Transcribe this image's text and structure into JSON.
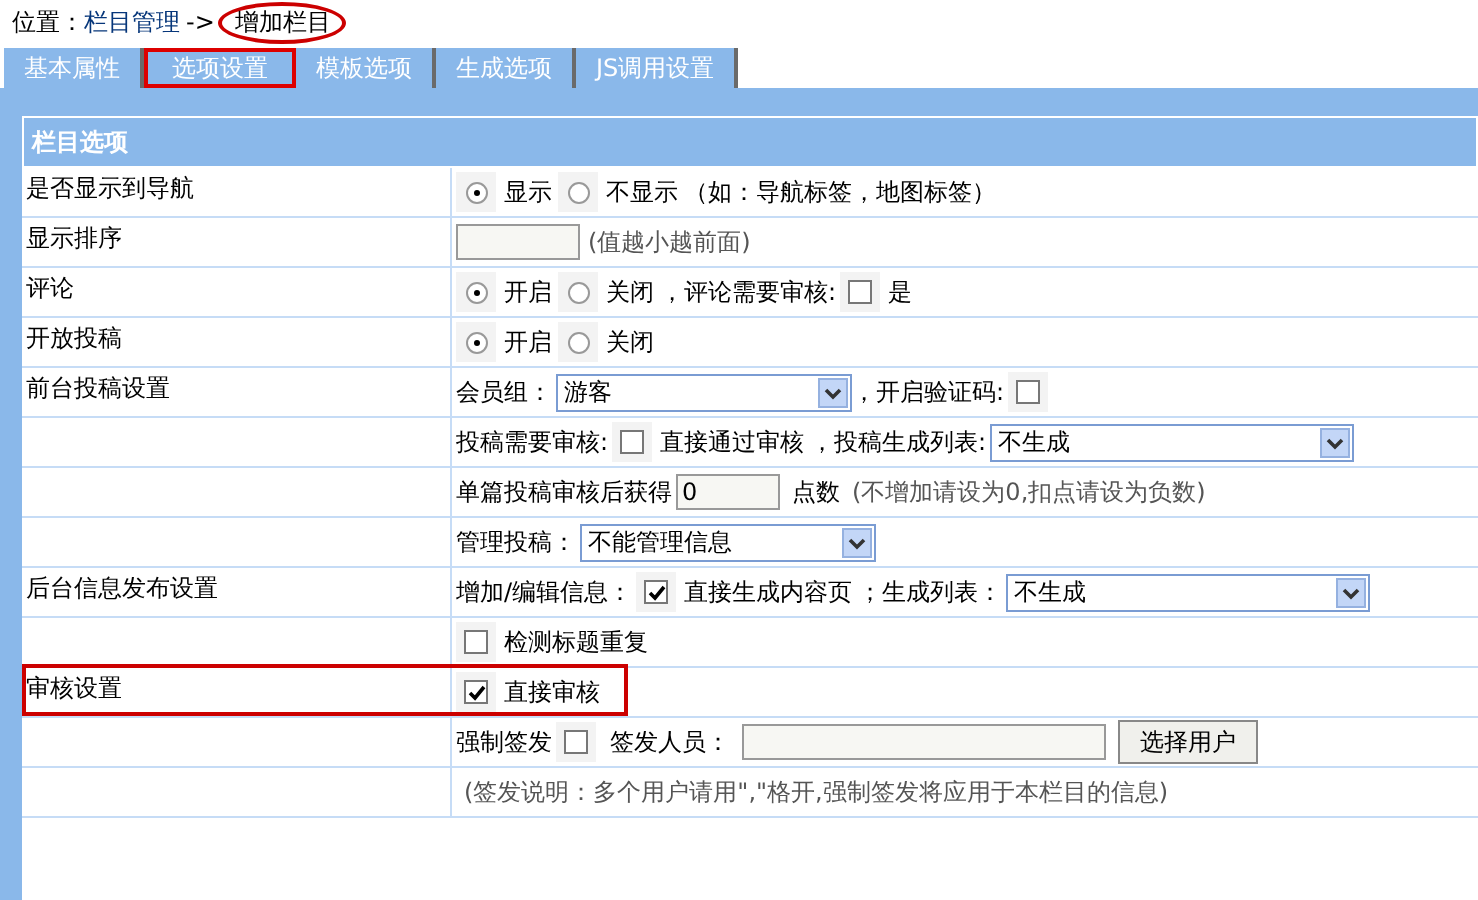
{
  "breadcrumb": {
    "prefix": "位置：",
    "link": "栏目管理",
    "separator": "->",
    "current": "增加栏目",
    "current_circled": true
  },
  "tabs": [
    {
      "label": "基本属性",
      "selected": false
    },
    {
      "label": "选项设置",
      "selected": true
    },
    {
      "label": "模板选项",
      "selected": false
    },
    {
      "label": "生成选项",
      "selected": false
    },
    {
      "label": "JS调用设置",
      "selected": false
    }
  ],
  "section_title": "栏目选项",
  "rows": [
    {
      "label": "是否显示到导航",
      "highlighted": false,
      "items": [
        {
          "kind": "radio",
          "label": "显示",
          "selected": true
        },
        {
          "kind": "radio",
          "label": "不显示",
          "selected": false
        },
        {
          "kind": "text",
          "text": "（如：导航标签，地图标签）"
        }
      ]
    },
    {
      "label": "显示排序",
      "highlighted": false,
      "items": [
        {
          "kind": "input",
          "value": ""
        },
        {
          "kind": "hint",
          "text": "(值越小越前面)"
        }
      ]
    },
    {
      "label": "评论",
      "highlighted": false,
      "items": [
        {
          "kind": "radio",
          "label": "开启",
          "selected": true
        },
        {
          "kind": "radio",
          "label": "关闭",
          "selected": false
        },
        {
          "kind": "text",
          "text": "，评论需要审核:"
        },
        {
          "kind": "checkbox",
          "label": "是",
          "checked": false
        }
      ]
    },
    {
      "label": "开放投稿",
      "highlighted": false,
      "items": [
        {
          "kind": "radio",
          "label": "开启",
          "selected": true
        },
        {
          "kind": "radio",
          "label": "关闭",
          "selected": false
        }
      ]
    },
    {
      "label": "前台投稿设置",
      "highlighted": false,
      "items": [
        {
          "kind": "text",
          "text": "会员组："
        },
        {
          "kind": "select",
          "value": "游客"
        },
        {
          "kind": "text",
          "text": "，开启验证码:"
        },
        {
          "kind": "checkbox",
          "checked": false
        }
      ]
    },
    {
      "highlighted": false,
      "items": [
        {
          "kind": "text",
          "text": "投稿需要审核:"
        },
        {
          "kind": "checkbox",
          "label": "直接通过审核",
          "checked": false
        },
        {
          "kind": "text",
          "text": "，投稿生成列表:"
        },
        {
          "kind": "select",
          "value": "不生成"
        }
      ]
    },
    {
      "highlighted": false,
      "items": [
        {
          "kind": "text",
          "text": "单篇投稿审核后获得"
        },
        {
          "kind": "input",
          "value": "0"
        },
        {
          "kind": "text",
          "text": "点数"
        },
        {
          "kind": "hint",
          "text": "(不增加请设为0,扣点请设为负数)"
        }
      ]
    },
    {
      "highlighted": false,
      "items": [
        {
          "kind": "text",
          "text": "管理投稿："
        },
        {
          "kind": "select",
          "value": "不能管理信息"
        }
      ]
    },
    {
      "label": "后台信息发布设置",
      "highlighted": false,
      "items": [
        {
          "kind": "text",
          "text": "增加/编辑信息："
        },
        {
          "kind": "checkbox",
          "label": "直接生成内容页",
          "checked": true
        },
        {
          "kind": "text",
          "text": "；生成列表："
        },
        {
          "kind": "select",
          "value": "不生成"
        }
      ]
    },
    {
      "highlighted": false,
      "items": [
        {
          "kind": "checkbox",
          "label": "检测标题重复",
          "checked": false
        }
      ]
    },
    {
      "label": "审核设置",
      "highlighted": true,
      "items": [
        {
          "kind": "checkbox",
          "label": "直接审核",
          "checked": true
        }
      ]
    },
    {
      "highlighted": false,
      "items": [
        {
          "kind": "text",
          "text": "强制签发"
        },
        {
          "kind": "checkbox",
          "checked": false
        },
        {
          "kind": "text",
          "text": "签发人员："
        },
        {
          "kind": "input",
          "value": ""
        },
        {
          "kind": "button",
          "label": "选择用户"
        }
      ]
    },
    {
      "highlighted": false,
      "items": [
        {
          "kind": "hint",
          "text": "(签发说明：多个用户请用\",\"格开,强制签发将应用于本栏目的信息)"
        }
      ]
    }
  ]
}
